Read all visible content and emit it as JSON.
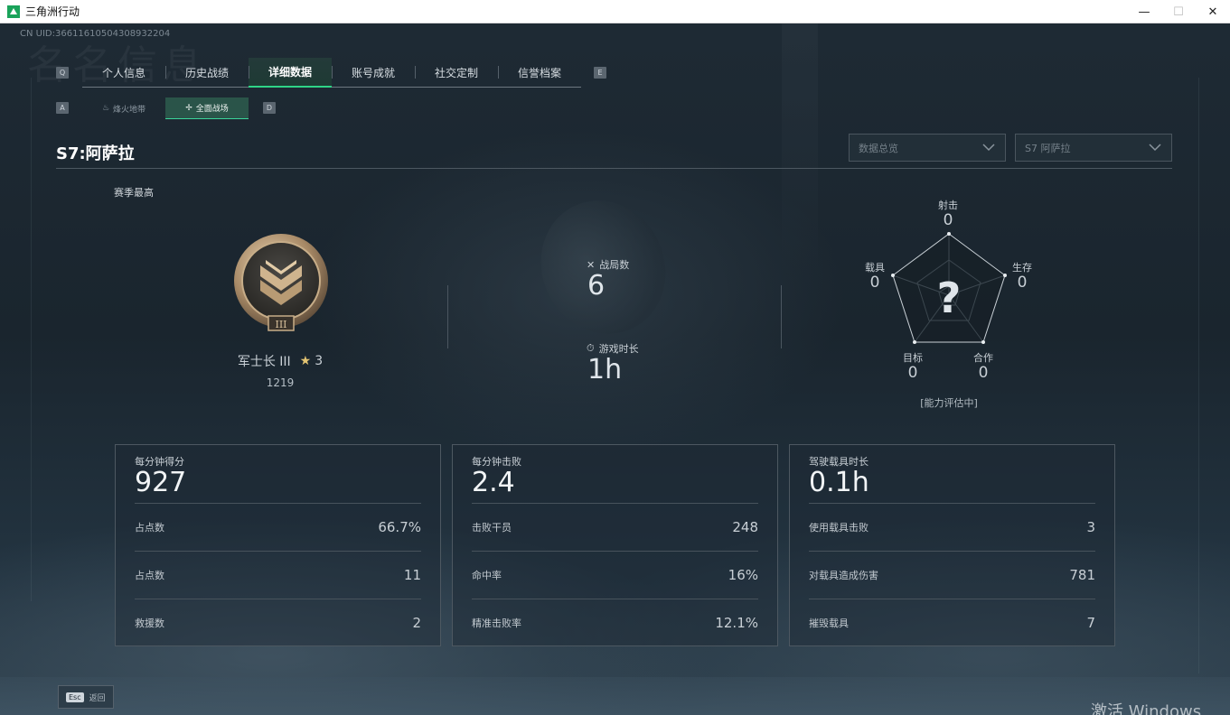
{
  "window": {
    "title": "三角洲行动",
    "minimize": "—",
    "maximize": "☐",
    "close": "✕"
  },
  "uid": "CN UID:36611610504308932204",
  "watermark": "名名信息",
  "main_tabs": {
    "left_key": "Q",
    "right_key": "E",
    "items": [
      {
        "label": "个人信息"
      },
      {
        "label": "历史战绩"
      },
      {
        "label": "详细数据",
        "active": true
      },
      {
        "label": "账号成就"
      },
      {
        "label": "社交定制"
      },
      {
        "label": "信誉档案"
      }
    ]
  },
  "sub_tabs": {
    "left_key": "A",
    "right_key": "D",
    "items": [
      {
        "label": "烽火地带"
      },
      {
        "label": "全面战场",
        "active": true
      }
    ]
  },
  "season_title": "S7:阿萨拉",
  "filters": {
    "data_overview": "数据总览",
    "season": "S7 阿萨拉"
  },
  "season_best_label": "赛季最高",
  "rank": {
    "name": "军士长 III",
    "stars": "3",
    "score": "1219"
  },
  "mid_stats": {
    "matches_label": "战局数",
    "matches_value": "6",
    "playtime_label": "游戏时长",
    "playtime_value": "1h"
  },
  "radar": {
    "shooting_label": "射击",
    "shooting_value": "0",
    "survival_label": "生存",
    "survival_value": "0",
    "cooperation_label": "合作",
    "cooperation_value": "0",
    "objective_label": "目标",
    "objective_value": "0",
    "vehicle_label": "载具",
    "vehicle_value": "0",
    "status": "[能力评估中]"
  },
  "cards": [
    {
      "head_label": "每分钟得分",
      "head_value": "927",
      "rows": [
        {
          "label": "占点数",
          "value": "66.7%"
        },
        {
          "label": "占点数",
          "value": "11"
        },
        {
          "label": "救援数",
          "value": "2"
        }
      ]
    },
    {
      "head_label": "每分钟击败",
      "head_value": "2.4",
      "rows": [
        {
          "label": "击败干员",
          "value": "248"
        },
        {
          "label": "命中率",
          "value": "16%"
        },
        {
          "label": "精准击败率",
          "value": "12.1%"
        }
      ]
    },
    {
      "head_label": "驾驶载具时长",
      "head_value": "0.1h",
      "rows": [
        {
          "label": "使用载具击败",
          "value": "3"
        },
        {
          "label": "对载具造成伤害",
          "value": "781"
        },
        {
          "label": "摧毁载具",
          "value": "7"
        }
      ]
    }
  ],
  "bottom": {
    "esc_key": "Esc",
    "esc_label": "返回",
    "activate_text": "激活 Windows"
  },
  "colors": {
    "accent": "#2fd487",
    "active_sub_tab": "#2d5c4e",
    "background": "#1b2630"
  }
}
